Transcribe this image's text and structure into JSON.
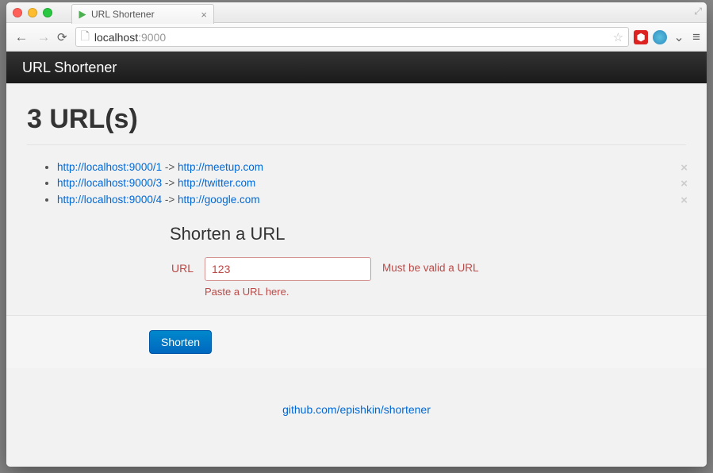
{
  "browser": {
    "tab_title": "URL Shortener",
    "url_host": "localhost",
    "url_port": ":9000"
  },
  "navbar": {
    "brand": "URL Shortener"
  },
  "header": {
    "title": "3 URL(s)"
  },
  "urls": [
    {
      "short": "http://localhost:9000/1",
      "long": "http://meetup.com"
    },
    {
      "short": "http://localhost:9000/3",
      "long": "http://twitter.com"
    },
    {
      "short": "http://localhost:9000/4",
      "long": "http://google.com"
    }
  ],
  "form": {
    "heading": "Shorten a URL",
    "label": "URL",
    "value": "123",
    "help": "Paste a URL here.",
    "error": "Must be valid a URL",
    "submit": "Shorten"
  },
  "footer": {
    "link_text": "github.com/epishkin/shortener"
  }
}
